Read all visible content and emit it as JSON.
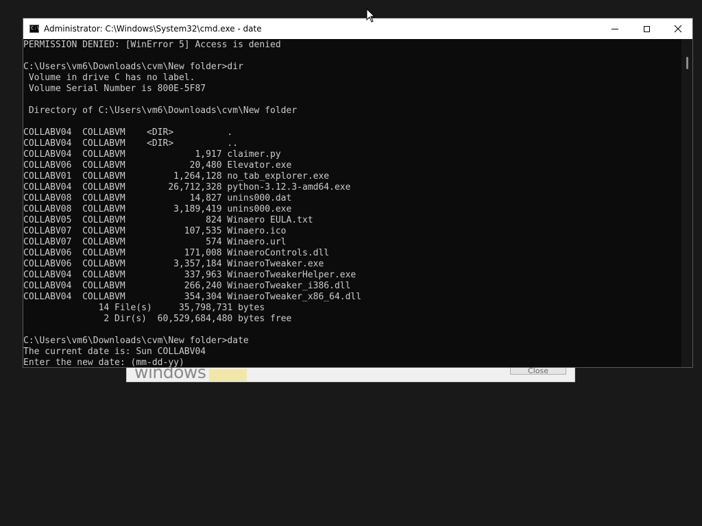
{
  "background_dialog": {
    "logo_text": "windows",
    "close_button_label": "Close"
  },
  "window": {
    "title": "Administrator: C:\\Windows\\System32\\cmd.exe - date",
    "icon_label": "C:\\"
  },
  "console": {
    "lines": [
      "PERMISSION DENIED: [WinError 5] Access is denied",
      "",
      "C:\\Users\\vm6\\Downloads\\cvm\\New folder>dir",
      " Volume in drive C has no label.",
      " Volume Serial Number is 800E-5F87",
      "",
      " Directory of C:\\Users\\vm6\\Downloads\\cvm\\New folder",
      "",
      "COLLABV04  COLLABVM    <DIR>          .",
      "COLLABV04  COLLABVM    <DIR>          ..",
      "COLLABV04  COLLABVM             1,917 claimer.py",
      "COLLABV06  COLLABVM            20,480 Elevator.exe",
      "COLLABV01  COLLABVM         1,264,128 no_tab_explorer.exe",
      "COLLABV04  COLLABVM        26,712,328 python-3.12.3-amd64.exe",
      "COLLABV08  COLLABVM            14,827 unins000.dat",
      "COLLABV08  COLLABVM         3,189,419 unins000.exe",
      "COLLABV05  COLLABVM               824 Winaero EULA.txt",
      "COLLABV07  COLLABVM           107,535 Winaero.ico",
      "COLLABV07  COLLABVM               574 Winaero.url",
      "COLLABV06  COLLABVM           171,008 WinaeroControls.dll",
      "COLLABV06  COLLABVM         3,357,184 WinaeroTweaker.exe",
      "COLLABV04  COLLABVM           337,963 WinaeroTweakerHelper.exe",
      "COLLABV04  COLLABVM           266,240 WinaeroTweaker_i386.dll",
      "COLLABV04  COLLABVM           354,304 WinaeroTweaker_x86_64.dll",
      "              14 File(s)     35,798,731 bytes",
      "               2 Dir(s)  60,529,684,480 bytes free",
      "",
      "C:\\Users\\vm6\\Downloads\\cvm\\New folder>date",
      "The current date is: Sun COLLABV04",
      "Enter the new date: (mm-dd-yy)"
    ]
  },
  "colors": {
    "console_bg": "#0c0c0c",
    "console_text": "#cccccc",
    "titlebar_bg": "#ffffff",
    "desktop_bg": "#191919"
  },
  "icons": {
    "minimize": "minimize-icon",
    "maximize": "maximize-icon",
    "close": "close-icon",
    "cmd": "cmd-app-icon",
    "cursor": "mouse-pointer-icon"
  }
}
